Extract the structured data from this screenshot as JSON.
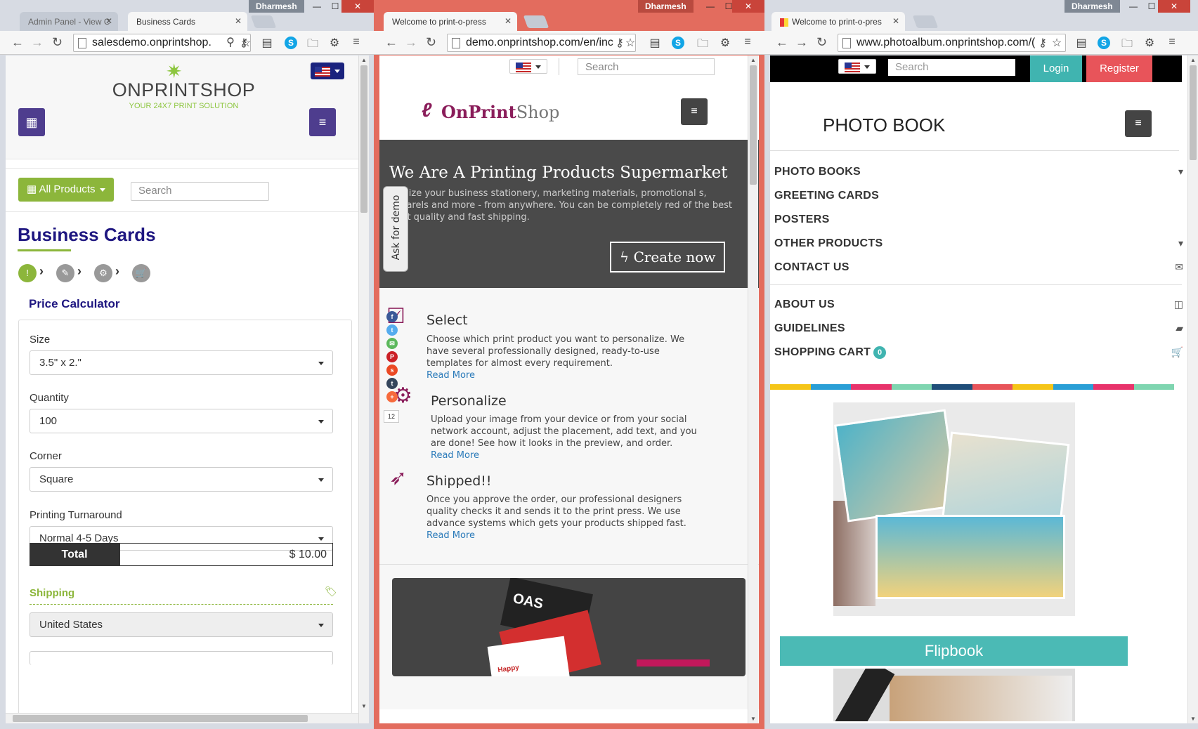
{
  "window1": {
    "tabs": [
      {
        "title": "Admin Panel - View C"
      },
      {
        "title": "Business Cards"
      }
    ],
    "user": "Dharmesh",
    "url": "salesdemo.onprintshop.",
    "logo": {
      "name": "ONPRINTSHOP",
      "tagline": "YOUR 24X7 PRINT SOLUTION"
    },
    "all_products_label": "All Products",
    "search_placeholder": "Search",
    "page_title": "Business Cards",
    "price_calculator_title": "Price Calculator",
    "fields": [
      {
        "label": "Size",
        "value": "3.5\" x 2.\""
      },
      {
        "label": "Quantity",
        "value": "100"
      },
      {
        "label": "Corner",
        "value": "Square"
      },
      {
        "label": "Printing Turnaround",
        "value": "Normal 4-5 Days"
      }
    ],
    "total_label": "Total",
    "total_value": "$ 10.00",
    "shipping_label": "Shipping",
    "shipping_country": "United States",
    "progress_steps": [
      "info-icon",
      "edit-icon",
      "options-icon",
      "cart-icon"
    ]
  },
  "window2": {
    "tabs": [
      {
        "title": "Welcome to print-o-press"
      }
    ],
    "user": "Dharmesh",
    "url": "demo.onprintshop.com/en/inc",
    "search_placeholder": "Search",
    "logo": {
      "part1": "OnPrint",
      "part2": "Shop"
    },
    "hero": {
      "title": "We Are A Printing Products Supermarket",
      "text": "onalize your business stationery, marketing materials, promotional s, apparels and more - from anywhere. You can be completely red of the best print quality and fast shipping.",
      "button": "Create now"
    },
    "ask_demo": "Ask for demo",
    "features": [
      {
        "title": "Select",
        "text": "Choose which print product you want to personalize. We have several professionally designed, ready-to-use templates for almost every requirement.",
        "link": "Read More"
      },
      {
        "title": "Personalize",
        "text": "Upload your image from your device or from your social network account, adjust the placement, add text, and you are done! See how it looks in the preview, and order.",
        "link": "Read More"
      },
      {
        "title": "Shipped!!",
        "text": "Once you approve the order, our professional designers quality checks it and sends it to the print press. We use advance systems which gets your products shipped fast.",
        "link": "Read More"
      }
    ],
    "share_count": "12",
    "card_text": {
      "brand": "OAS",
      "greeting": "Happy"
    }
  },
  "window3": {
    "tabs": [
      {
        "title": "Welcome to print-o-pres"
      }
    ],
    "user": "Dharmesh",
    "url": "www.photoalbum.onprintshop.com/(",
    "search_placeholder": "Search",
    "login": "Login",
    "register": "Register",
    "title": "PHOTO BOOK",
    "menu": [
      {
        "label": "PHOTO BOOKS",
        "icon": "caret-down-icon"
      },
      {
        "label": "GREETING CARDS",
        "icon": ""
      },
      {
        "label": "POSTERS",
        "icon": ""
      },
      {
        "label": "OTHER PRODUCTS",
        "icon": "caret-down-icon"
      },
      {
        "label": "CONTACT US",
        "icon": "envelope-icon"
      },
      {
        "label": "ABOUT US",
        "icon": "columns-icon"
      },
      {
        "label": "GUIDELINES",
        "icon": "book-icon"
      },
      {
        "label": "SHOPPING CART",
        "icon": "cart-icon"
      }
    ],
    "cart_count": "0",
    "stripe_colors": [
      "#f5c518",
      "#2a9fd6",
      "#e8336b",
      "#7fd5b0",
      "#1f4e79",
      "#e8545a",
      "#f5c518",
      "#2a9fd6",
      "#e8336b",
      "#7fd5b0"
    ],
    "flipbook_label": "Flipbook"
  },
  "colors": {
    "purple": "#4e3d8e",
    "green": "#8cb63b",
    "teal": "#40b4b0",
    "red": "#e8545a",
    "magenta": "#8a1d5a"
  }
}
